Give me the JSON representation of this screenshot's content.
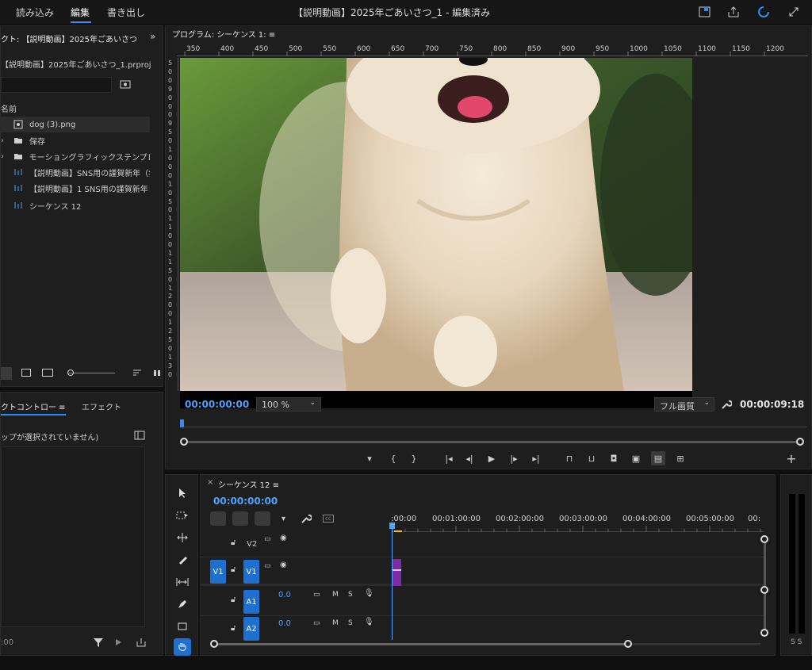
{
  "menu": {
    "import": "読み込み",
    "edit": "編集",
    "export": "書き出し"
  },
  "window_title": "【説明動画】2025年ごあいさつ_1 - 編集済み",
  "project_panel": {
    "tab_title": "クト: 【説明動画】2025年ごあいさつ",
    "project_file": "【説明動画】2025年ごあいさつ_1.prproj",
    "column_name": "名前",
    "items": [
      {
        "name": "dog (3).png",
        "type": "image"
      },
      {
        "name": "保存",
        "type": "folder"
      },
      {
        "name": "モーショングラフィックステンプレ",
        "type": "folder"
      },
      {
        "name": "【説明動画】SNS用の謹賀新年（年",
        "type": "sequence"
      },
      {
        "name": "【説明動画】1 SNS用の謹賀新年（",
        "type": "sequence"
      },
      {
        "name": "シーケンス 12",
        "type": "sequence"
      }
    ]
  },
  "effect_panel": {
    "tab1": "クトコントロー ≡",
    "tab2": "エフェクト",
    "no_clip": "ップが選択されていません)",
    "timecode": ":00"
  },
  "program_monitor": {
    "title": "プログラム: シーケンス 1: ≡",
    "ruler_numbers": [
      "350",
      "400",
      "450",
      "500",
      "550",
      "600",
      "650",
      "700",
      "750",
      "800",
      "850",
      "900",
      "950",
      "1000",
      "1050",
      "1100",
      "1150",
      "1200"
    ],
    "left_ruler": [
      "5",
      "0",
      "0",
      "9",
      "0",
      "0",
      "0",
      "9",
      "5",
      "0",
      "1",
      "0",
      "0",
      "0",
      "1",
      "0",
      "5",
      "0",
      "1",
      "1",
      "0",
      "0",
      "1",
      "1",
      "5",
      "0",
      "1",
      "2",
      "0",
      "0",
      "1",
      "2",
      "5",
      "0",
      "1",
      "3",
      "0"
    ],
    "timecode_current": "00:00:00:00",
    "zoom": "100 %",
    "quality": "フル画質",
    "duration": "00:00:09:18"
  },
  "timeline": {
    "tab": "シーケンス 12 ≡",
    "timecode": "00:00:00:00",
    "ruler": [
      ":00:00",
      "00:01:00:00",
      "00:02:00:00",
      "00:03:00:00",
      "00:04:00:00",
      "00:05:00:00",
      "00:"
    ],
    "tracks": [
      {
        "label": "V2"
      },
      {
        "label": "V1",
        "source": "V1"
      },
      {
        "label": "A1",
        "vol": "0.0"
      },
      {
        "label": "A2",
        "vol": "0.0"
      }
    ]
  },
  "audio_meter": {
    "labels": "S S"
  },
  "colors": {
    "accent": "#2f8cff",
    "clip": "#7d2aa6",
    "track_blue": "#1f6fd1"
  }
}
